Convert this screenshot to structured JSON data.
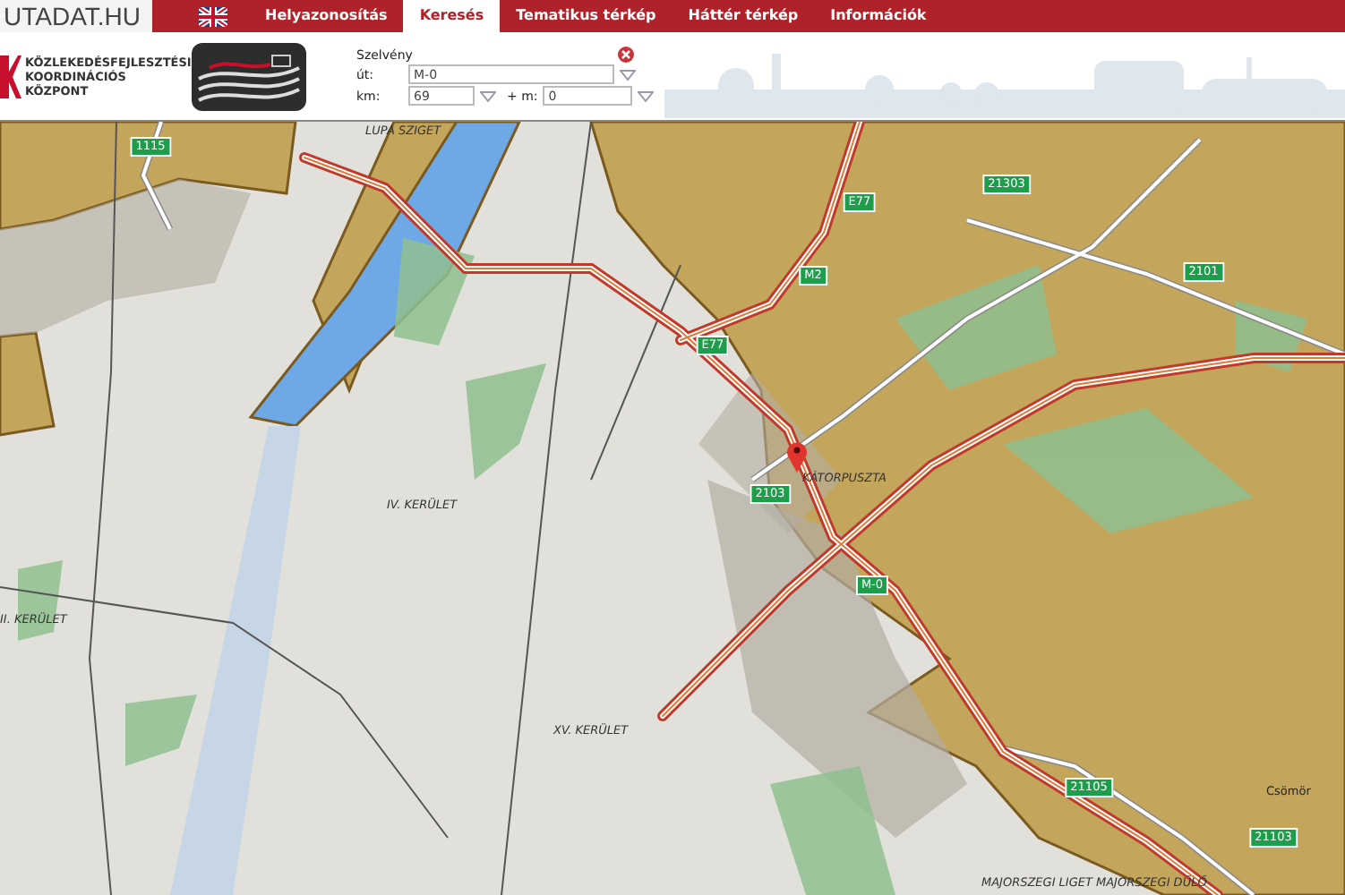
{
  "site_title": "UTADAT.HU",
  "nav": {
    "tabs": [
      {
        "label": "Helyazonosítás",
        "selected": false
      },
      {
        "label": "Keresés",
        "selected": true
      },
      {
        "label": "Tematikus térkép",
        "selected": false
      },
      {
        "label": "Háttér térkép",
        "selected": false
      },
      {
        "label": "Információk",
        "selected": false
      }
    ]
  },
  "brand": {
    "name_lines": [
      "KÖZLEKEDÉSFEJLESZTÉSI",
      "KOORDINÁCIÓS",
      "KÖZPONT"
    ]
  },
  "search_panel": {
    "title": "Szelvény",
    "fields": [
      {
        "label": "út:",
        "value": "M-0"
      },
      {
        "label": "km:",
        "value": "69"
      },
      {
        "label": "+ m:",
        "value": "0"
      }
    ]
  },
  "map": {
    "labels": [
      {
        "text": "LUPA SZIGET",
        "kind": "place"
      },
      {
        "text": "IV. KERÜLET",
        "kind": "district"
      },
      {
        "text": "II. KERÜLET",
        "kind": "district"
      },
      {
        "text": "XV. KERÜLET",
        "kind": "district"
      },
      {
        "text": "KÁTORPUSZTA",
        "kind": "place"
      },
      {
        "text": "Csömör",
        "kind": "town"
      },
      {
        "text": "MAJORSZEGI LIGET",
        "kind": "place"
      },
      {
        "text": "MAJORSZEGI DŰLŐ",
        "kind": "place"
      }
    ],
    "shields": [
      {
        "text": "1115"
      },
      {
        "text": "E77"
      },
      {
        "text": "M2"
      },
      {
        "text": "21303"
      },
      {
        "text": "2101"
      },
      {
        "text": "E77"
      },
      {
        "text": "2103"
      },
      {
        "text": "M-0"
      },
      {
        "text": "21105"
      },
      {
        "text": "21103"
      }
    ]
  }
}
